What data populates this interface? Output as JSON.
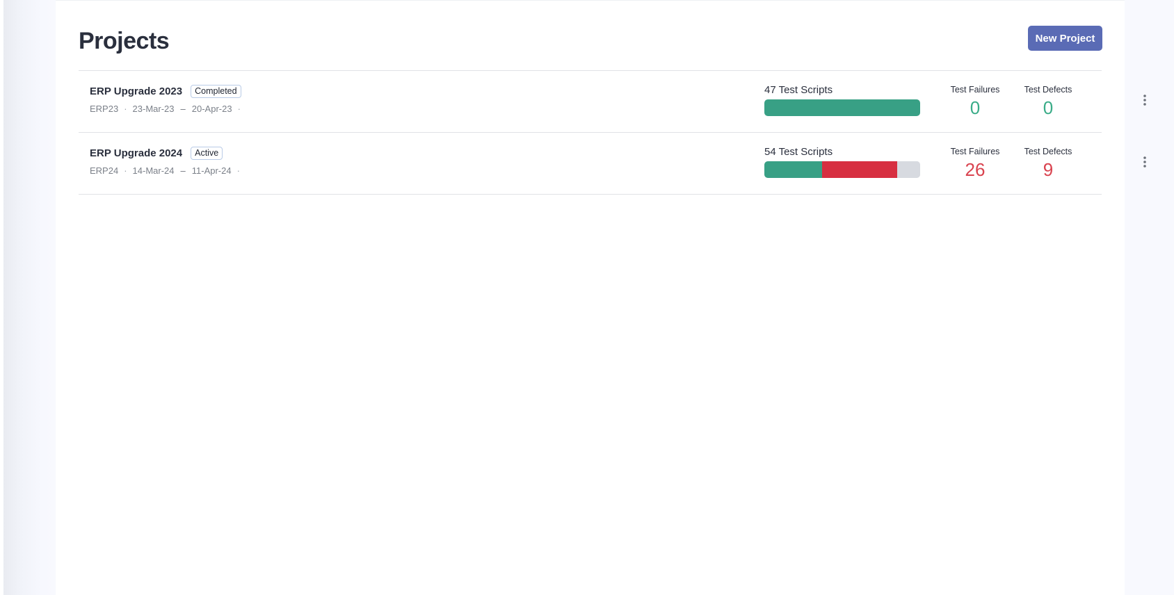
{
  "header": {
    "title": "Projects",
    "new_project_label": "New Project"
  },
  "colors": {
    "accent": "#5a6bb5",
    "pass": "#38a085",
    "fail": "#d72f41",
    "pending": "#d7dae0",
    "good_value": "#3aac88",
    "bad_value": "#d9434f"
  },
  "projects": [
    {
      "name": "ERP Upgrade 2023",
      "status": "Completed",
      "code": "ERP23",
      "start": "23-Mar-23",
      "end": "20-Apr-23",
      "separator": "·",
      "range_dash": "–",
      "scripts_label": "47 Test Scripts",
      "scripts_total": 47,
      "progress": {
        "passed": 47,
        "failed": 0,
        "remaining": 0
      },
      "failures_label": "Test Failures",
      "failures": "0",
      "defects_label": "Test Defects",
      "defects": "0",
      "value_state": "good",
      "menu_icon": "more-vertical-icon"
    },
    {
      "name": "ERP Upgrade 2024",
      "status": "Active",
      "code": "ERP24",
      "start": "14-Mar-24",
      "end": "11-Apr-24",
      "separator": "·",
      "range_dash": "–",
      "scripts_label": "54 Test Scripts",
      "scripts_total": 54,
      "progress": {
        "passed": 20,
        "failed": 26,
        "remaining": 8
      },
      "failures_label": "Test Failures",
      "failures": "26",
      "defects_label": "Test Defects",
      "defects": "9",
      "value_state": "bad",
      "menu_icon": "more-vertical-icon"
    }
  ]
}
